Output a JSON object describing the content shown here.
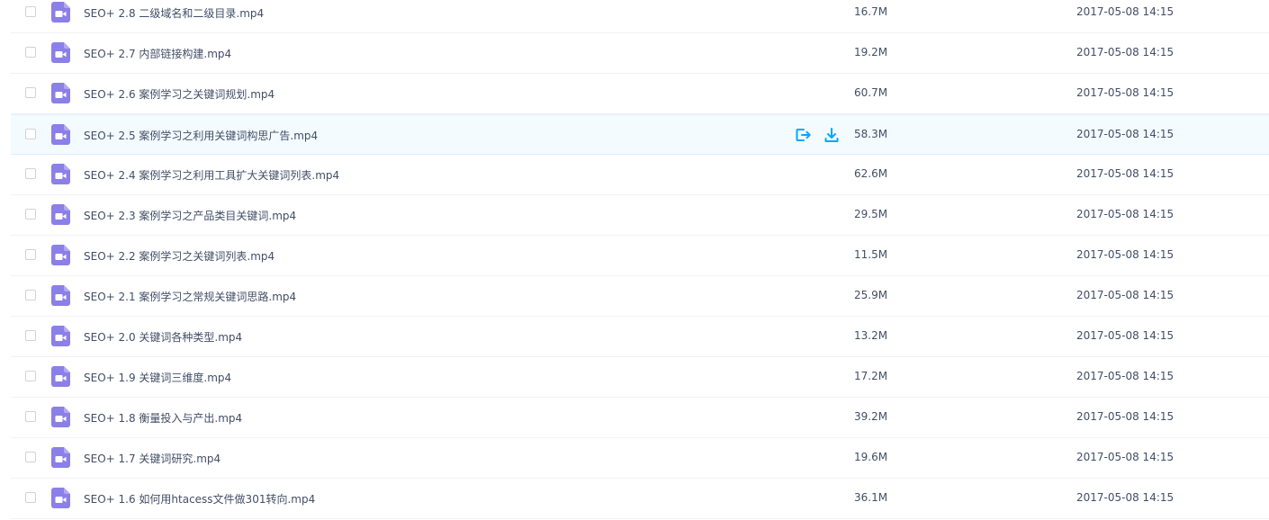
{
  "colors": {
    "video_icon": "#8b7fe8",
    "action_icon": "#06a7ff",
    "text": "#424e67",
    "hover_row": "#f4fbff"
  },
  "hover_actions": {
    "share_icon": "share-icon",
    "download_icon": "download-icon"
  },
  "files": [
    {
      "name": "SEO+ 2.8 二级域名和二级目录.mp4",
      "size": "16.7M",
      "date": "2017-05-08 14:15",
      "icon": "video-file-icon",
      "hovered": false
    },
    {
      "name": "SEO+ 2.7 内部链接构建.mp4",
      "size": "19.2M",
      "date": "2017-05-08 14:15",
      "icon": "video-file-icon",
      "hovered": false
    },
    {
      "name": "SEO+ 2.6 案例学习之关键词规划.mp4",
      "size": "60.7M",
      "date": "2017-05-08 14:15",
      "icon": "video-file-icon",
      "hovered": false
    },
    {
      "name": "SEO+ 2.5 案例学习之利用关键词构思广告.mp4",
      "size": "58.3M",
      "date": "2017-05-08 14:15",
      "icon": "video-file-icon",
      "hovered": true
    },
    {
      "name": "SEO+ 2.4 案例学习之利用工具扩大关键词列表.mp4",
      "size": "62.6M",
      "date": "2017-05-08 14:15",
      "icon": "video-file-icon",
      "hovered": false
    },
    {
      "name": "SEO+ 2.3 案例学习之产品类目关键词.mp4",
      "size": "29.5M",
      "date": "2017-05-08 14:15",
      "icon": "video-file-icon",
      "hovered": false
    },
    {
      "name": "SEO+ 2.2 案例学习之关键词列表.mp4",
      "size": "11.5M",
      "date": "2017-05-08 14:15",
      "icon": "video-file-icon",
      "hovered": false
    },
    {
      "name": "SEO+ 2.1 案例学习之常规关键词思路.mp4",
      "size": "25.9M",
      "date": "2017-05-08 14:15",
      "icon": "video-file-icon",
      "hovered": false
    },
    {
      "name": "SEO+ 2.0 关键词各种类型.mp4",
      "size": "13.2M",
      "date": "2017-05-08 14:15",
      "icon": "video-file-icon",
      "hovered": false
    },
    {
      "name": "SEO+ 1.9 关键词三维度.mp4",
      "size": "17.2M",
      "date": "2017-05-08 14:15",
      "icon": "video-file-icon",
      "hovered": false
    },
    {
      "name": "SEO+ 1.8 衡量投入与产出.mp4",
      "size": "39.2M",
      "date": "2017-05-08 14:15",
      "icon": "video-file-icon",
      "hovered": false
    },
    {
      "name": "SEO+ 1.7 关键词研究.mp4",
      "size": "19.6M",
      "date": "2017-05-08 14:15",
      "icon": "video-file-icon",
      "hovered": false
    },
    {
      "name": "SEO+ 1.6 如何用htacess文件做301转向.mp4",
      "size": "36.1M",
      "date": "2017-05-08 14:15",
      "icon": "video-file-icon",
      "hovered": false
    }
  ]
}
